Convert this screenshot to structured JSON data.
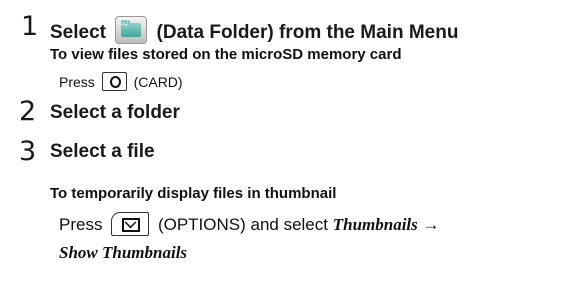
{
  "steps": [
    {
      "number": "1",
      "title_prefix": "Select",
      "icon": "data-folder-icon",
      "title_suffix": "(Data Folder) from the Main Menu",
      "subhead": "To view files stored on the microSD memory card",
      "press_prefix": "Press",
      "key_icon": "card-key-icon",
      "press_suffix": "(CARD)"
    },
    {
      "number": "2",
      "title": "Select a folder"
    },
    {
      "number": "3",
      "title": "Select a file",
      "subhead": "To temporarily display files in thumbnail",
      "press_prefix": "Press",
      "key_icon": "options-key-icon",
      "press_middle": "(OPTIONS) and select",
      "menu_item_1": "Thumbnails",
      "arrow": "→",
      "menu_item_2": "Show Thumbnails"
    }
  ]
}
